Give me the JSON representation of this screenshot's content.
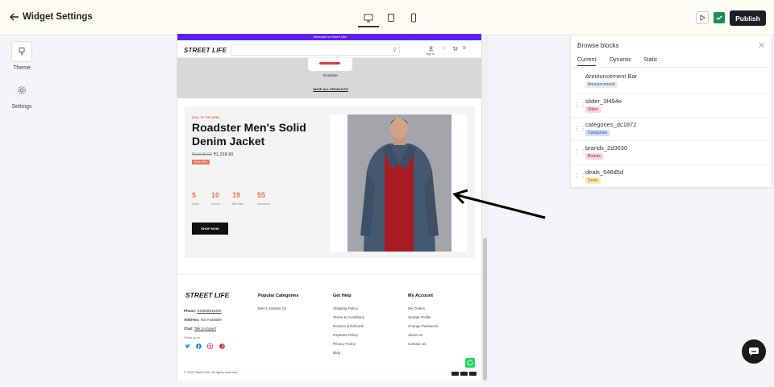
{
  "header": {
    "title": "Widget Settings",
    "publish_label": "Publish"
  },
  "left_rail": {
    "theme_label": "Theme",
    "settings_label": "Settings"
  },
  "store": {
    "announcement": "Welcome to Street Life!",
    "logo": "STREET LIFE",
    "signin_label": "Sign In",
    "category_name": "Roadster",
    "shop_all": "SHOP ALL PRODUCTS",
    "deal": {
      "tag": "DEAL OF THE WEEK",
      "title": "Roadster Men's Solid Denim Jacket",
      "old_price": "₹1,648.90",
      "price": "₹1,318.90",
      "save": "Save 20%",
      "countdown": [
        {
          "num": "5",
          "label": "Days"
        },
        {
          "num": "10",
          "label": "Hours"
        },
        {
          "num": "19",
          "label": "Minutes"
        },
        {
          "num": "55",
          "label": "Seconds"
        }
      ],
      "cta": "SHOP NOW"
    },
    "footer": {
      "logo": "STREET LIFE",
      "phone_label": "Phone:",
      "phone": "919869918490",
      "address_label": "Address:",
      "address": "Not Available",
      "chat_label": "Chat:",
      "chat": "Talk to Expert",
      "follow": "Follow us on",
      "col1_title": "Popular Categories",
      "col1_links": [
        "Men's Jackets (1)"
      ],
      "col2_title": "Get Help",
      "col2_links": [
        "Shipping Policy",
        "Terms & Conditions",
        "Returns & Refunds",
        "Payment Policy",
        "Privacy Policy",
        "Blog"
      ],
      "col3_title": "My Account",
      "col3_links": [
        "My Orders",
        "Update Profile",
        "Change Password",
        "About Us",
        "Contact Us"
      ],
      "copyright": "© 2022 Street Life. All rights reserved"
    }
  },
  "panel": {
    "title": "Browse blocks",
    "tabs": [
      "Current",
      "Dynamic",
      "Static"
    ],
    "blocks": [
      {
        "name": "Announcement Bar",
        "badge": "Announcement",
        "color": "#e8ecf2"
      },
      {
        "name": "slider_3f494e",
        "badge": "Slider",
        "color": "#fbd3e4"
      },
      {
        "name": "categories_dc1872",
        "badge": "Categories",
        "color": "#cfe0fb"
      },
      {
        "name": "brands_2d3630",
        "badge": "Brands",
        "color": "#fbd3da"
      },
      {
        "name": "deals_546d5d",
        "badge": "Deals",
        "color": "#fbeab1"
      }
    ]
  }
}
